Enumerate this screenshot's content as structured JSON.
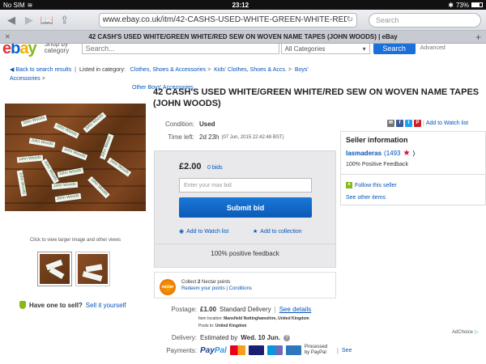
{
  "status_bar": {
    "carrier": "No SIM",
    "time": "23:12",
    "battery": "73%",
    "battery_fill": 0.73
  },
  "browser": {
    "url": "www.ebay.co.uk/itm/42-CASHS-USED-WHITE-GREEN-WHITE-RED-SEW-O",
    "search_placeholder": "Search",
    "tab_title": "42 CASH'S USED WHITE/GREEN WHITE/RED SEW ON WOVEN NAME TAPES (JOHN WOODS) | eBay"
  },
  "header": {
    "shop_by": "Shop by category",
    "search_placeholder": "Search...",
    "category": "All Categories",
    "search_button": "Search",
    "advanced": "Advanced"
  },
  "breadcrumbs": {
    "back": "Back to search results",
    "listed_in": "Listed in category:",
    "items": [
      "Clothes, Shoes & Accessories",
      "Kids' Clothes, Shoes & Accs.",
      "Boys' Accessories",
      "Other Boys' Accessories"
    ]
  },
  "item": {
    "title": "42 CASH'S USED WHITE/GREEN WHITE/RED SEW ON WOVEN NAME TAPES (JOHN WOODS)",
    "condition_label": "Condition:",
    "condition": "Used",
    "time_left_label": "Time left:",
    "time_left": "2d 23h",
    "end_time": "(07 Jun, 2015   22:42:48 BST)",
    "add_to_watch_list": "Add to Watch list",
    "tape_text": "John Woods"
  },
  "gallery": {
    "caption": "Click to view larger image and other views"
  },
  "sell": {
    "prompt": "Have one to sell?",
    "link": "Sell it yourself"
  },
  "bid": {
    "price": "£2.00",
    "bids": "0 bids",
    "input_placeholder": "Enter your max bid",
    "submit": "Submit bid",
    "watch": "Add to Watch list",
    "collection": "Add to collection",
    "feedback": "100% positive feedback"
  },
  "nectar": {
    "logo": "nectar",
    "collect_prefix": "Collect",
    "points": "2",
    "collect_suffix": "Nectar points",
    "redeem": "Redeem your points",
    "conditions": "Conditions"
  },
  "postage": {
    "label": "Postage:",
    "price": "£1.00",
    "service": "Standard Delivery",
    "details": "See details",
    "location_label": "Item location:",
    "location": "Mansfield Nottinghamshire, United Kingdom",
    "posts_to_label": "Posts to:",
    "posts_to": "United Kingdom"
  },
  "delivery": {
    "label": "Delivery:",
    "estimated": "Estimated by",
    "date": "Wed. 10 Jun."
  },
  "payments": {
    "label": "Payments:",
    "paypal_a": "Pay",
    "paypal_b": "Pal",
    "processed": "Processed by PayPal",
    "see": "See"
  },
  "seller": {
    "heading": "Seller information",
    "name": "lasmaderas",
    "score": "(1493",
    "score_close": ")",
    "positive": "100% Positive Feedback",
    "follow": "Follow this seller",
    "other_items": "See other items"
  },
  "ad": {
    "label": "AdChoice"
  }
}
